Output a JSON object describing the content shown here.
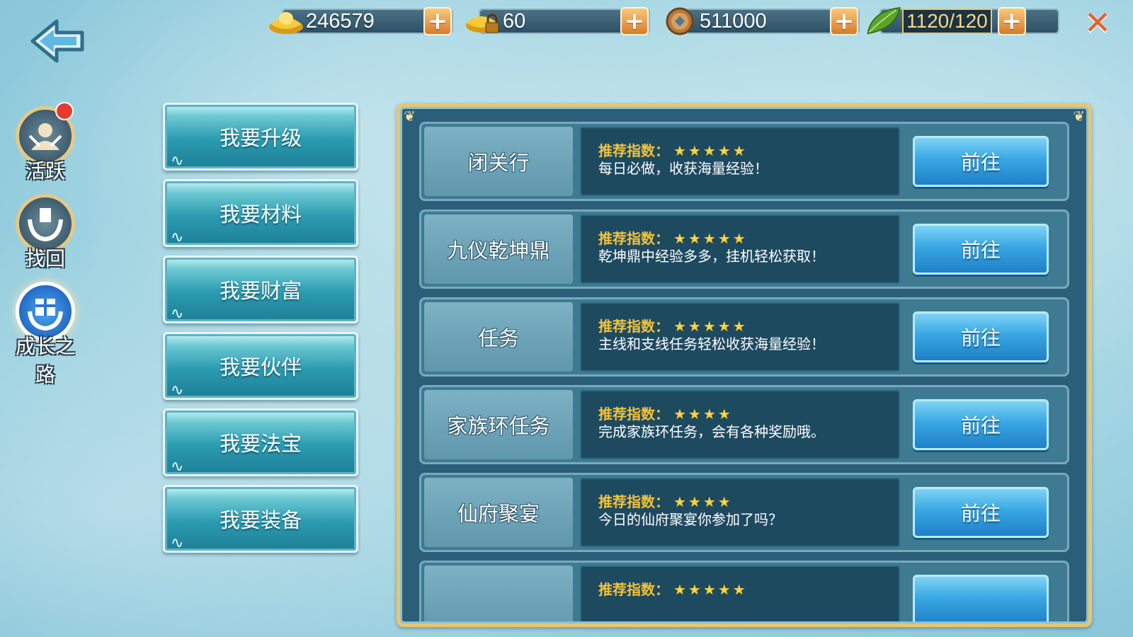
{
  "resources": {
    "gold": "246579",
    "bound_gold": "60",
    "coins": "511000",
    "stamina": "1120/120"
  },
  "side_menu": [
    {
      "label": "活跃",
      "icon": "activity-icon",
      "has_badge": true,
      "active": false
    },
    {
      "label": "找回",
      "icon": "retrieve-icon",
      "has_badge": false,
      "active": false
    },
    {
      "label": "成长之路",
      "icon": "gift-icon",
      "has_badge": false,
      "active": true
    }
  ],
  "categories": [
    {
      "label": "我要升级"
    },
    {
      "label": "我要材料"
    },
    {
      "label": "我要财富"
    },
    {
      "label": "我要伙伴"
    },
    {
      "label": "我要法宝"
    },
    {
      "label": "我要装备"
    }
  ],
  "recommend_label": "推荐指数：",
  "activities": [
    {
      "name": "闭关行",
      "stars": 5,
      "desc": "每日必做，收获海量经验！",
      "button": "前往"
    },
    {
      "name": "九仪乾坤鼎",
      "stars": 5,
      "desc": "乾坤鼎中经验多多，挂机轻松获取！",
      "button": "前往"
    },
    {
      "name": "任务",
      "stars": 5,
      "desc": "主线和支线任务轻松收获海量经验！",
      "button": "前往"
    },
    {
      "name": "家族环任务",
      "stars": 4,
      "desc": "完成家族环任务，会有各种奖励哦。",
      "button": "前往"
    },
    {
      "name": "仙府聚宴",
      "stars": 4,
      "desc": "今日的仙府聚宴你参加了吗？",
      "button": "前往"
    },
    {
      "name": "",
      "stars": 5,
      "desc": "",
      "button": ""
    }
  ]
}
